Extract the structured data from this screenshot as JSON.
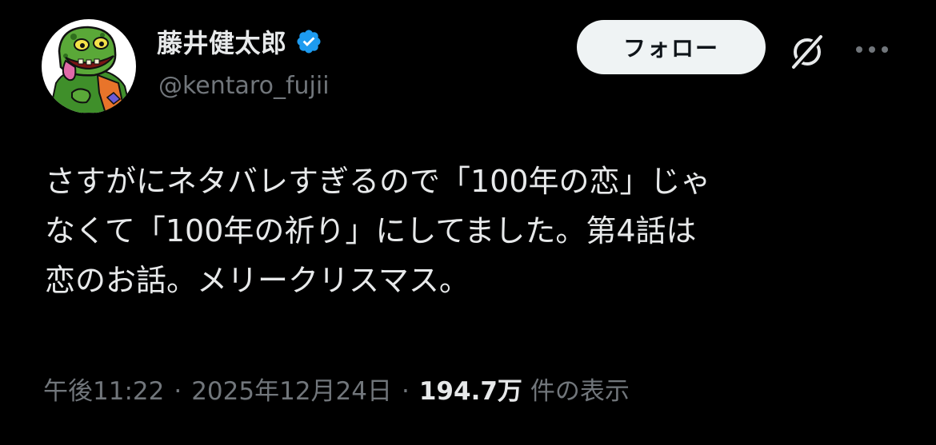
{
  "author": {
    "display_name": "藤井健太郎",
    "handle": "@kentaro_fujii",
    "verified": true,
    "verified_color": "#1d9bf0",
    "avatar_icon": "green-monster-avatar"
  },
  "actions": {
    "follow_label": "フォロー",
    "grok_icon": "grok-icon",
    "more_icon": "more-icon"
  },
  "tweet": {
    "lines": [
      "さすがにネタバレすぎるので「100年の恋」じゃ",
      "なくて「100年の祈り」にしてました。第4話は",
      "恋のお話。メリークリスマス。"
    ]
  },
  "meta": {
    "time": "午後11:22",
    "separator": "·",
    "date": "2025年12月24日",
    "views_count": "194.7万",
    "views_label": "件の表示"
  }
}
